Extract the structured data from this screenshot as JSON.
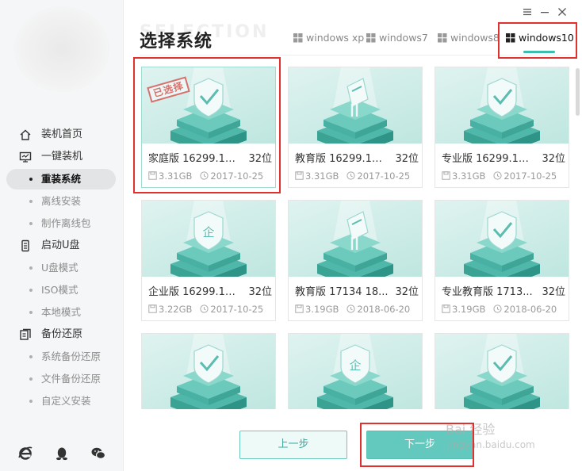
{
  "sidebar": {
    "items": [
      {
        "label": "装机首页",
        "type": "top",
        "icon": "home-icon"
      },
      {
        "label": "一键装机",
        "type": "top",
        "icon": "monitor-icon"
      },
      {
        "label": "重装系统",
        "type": "sub",
        "active": true
      },
      {
        "label": "离线安装",
        "type": "sub"
      },
      {
        "label": "制作离线包",
        "type": "sub"
      },
      {
        "label": "启动U盘",
        "type": "top",
        "icon": "usb-drive-icon"
      },
      {
        "label": "U盘模式",
        "type": "sub"
      },
      {
        "label": "ISO模式",
        "type": "sub"
      },
      {
        "label": "本地模式",
        "type": "sub"
      },
      {
        "label": "备份还原",
        "type": "top",
        "icon": "backup-icon"
      },
      {
        "label": "系统备份还原",
        "type": "sub"
      },
      {
        "label": "文件备份还原",
        "type": "sub"
      },
      {
        "label": "自定义安装",
        "type": "sub"
      }
    ],
    "footer_icons": [
      "ie-browser-icon",
      "qq-penguin-icon",
      "wechat-icon"
    ]
  },
  "header": {
    "title": "选择系统",
    "title_bg": "SELECTION"
  },
  "window_controls": [
    "menu-icon",
    "minimize-icon",
    "close-icon"
  ],
  "tabs": [
    {
      "label": "windows xp",
      "active": false
    },
    {
      "label": "windows7",
      "active": false
    },
    {
      "label": "windows8",
      "active": false
    },
    {
      "label": "windows10",
      "active": true
    }
  ],
  "cards": [
    {
      "name": "家庭版 16299.15 ...",
      "bits": "32位",
      "size": "3.31GB",
      "date": "2017-10-25",
      "selected": true,
      "stamp": "已选择",
      "badge": "check"
    },
    {
      "name": "教育版 16299.15 ...",
      "bits": "32位",
      "size": "3.31GB",
      "date": "2017-10-25",
      "badge": "book"
    },
    {
      "name": "专业版 16299.15 ...",
      "bits": "32位",
      "size": "3.31GB",
      "date": "2017-10-25",
      "badge": "check"
    },
    {
      "name": "企业版 16299.15 ...",
      "bits": "32位",
      "size": "3.22GB",
      "date": "2017-10-25",
      "badge": "enterprise",
      "badge_text": "企"
    },
    {
      "name": "教育版 17134 18...",
      "bits": "32位",
      "size": "3.19GB",
      "date": "2018-06-20",
      "badge": "book"
    },
    {
      "name": "专业教育版 1713...",
      "bits": "32位",
      "size": "3.19GB",
      "date": "2018-06-20",
      "badge": "check"
    },
    {
      "name": "",
      "bits": "",
      "size": "",
      "date": "",
      "badge": "check"
    },
    {
      "name": "",
      "bits": "",
      "size": "",
      "date": "",
      "badge": "enterprise",
      "badge_text": "企"
    },
    {
      "name": "",
      "bits": "",
      "size": "",
      "date": "",
      "badge": "check"
    }
  ],
  "buttons": {
    "prev": "上一步",
    "next": "下一步"
  },
  "watermark": {
    "main": "Bai 经验",
    "sub": "jingyan.baidu.com"
  },
  "colors": {
    "accent": "#63c9be",
    "thumb": "#bfe6e0",
    "annotation_red": "#e03030",
    "stamp": "#d7716d"
  }
}
